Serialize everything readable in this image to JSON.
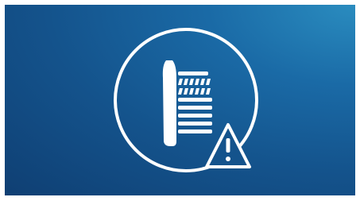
{
  "illustration": {
    "subject": "brush-head-replacement-warning",
    "icons": [
      "brush-head-icon",
      "warning-triangle-icon"
    ],
    "colors": {
      "background_dark": "#0f3f73",
      "background_light": "#2a8cbf",
      "line": "#ffffff"
    }
  }
}
